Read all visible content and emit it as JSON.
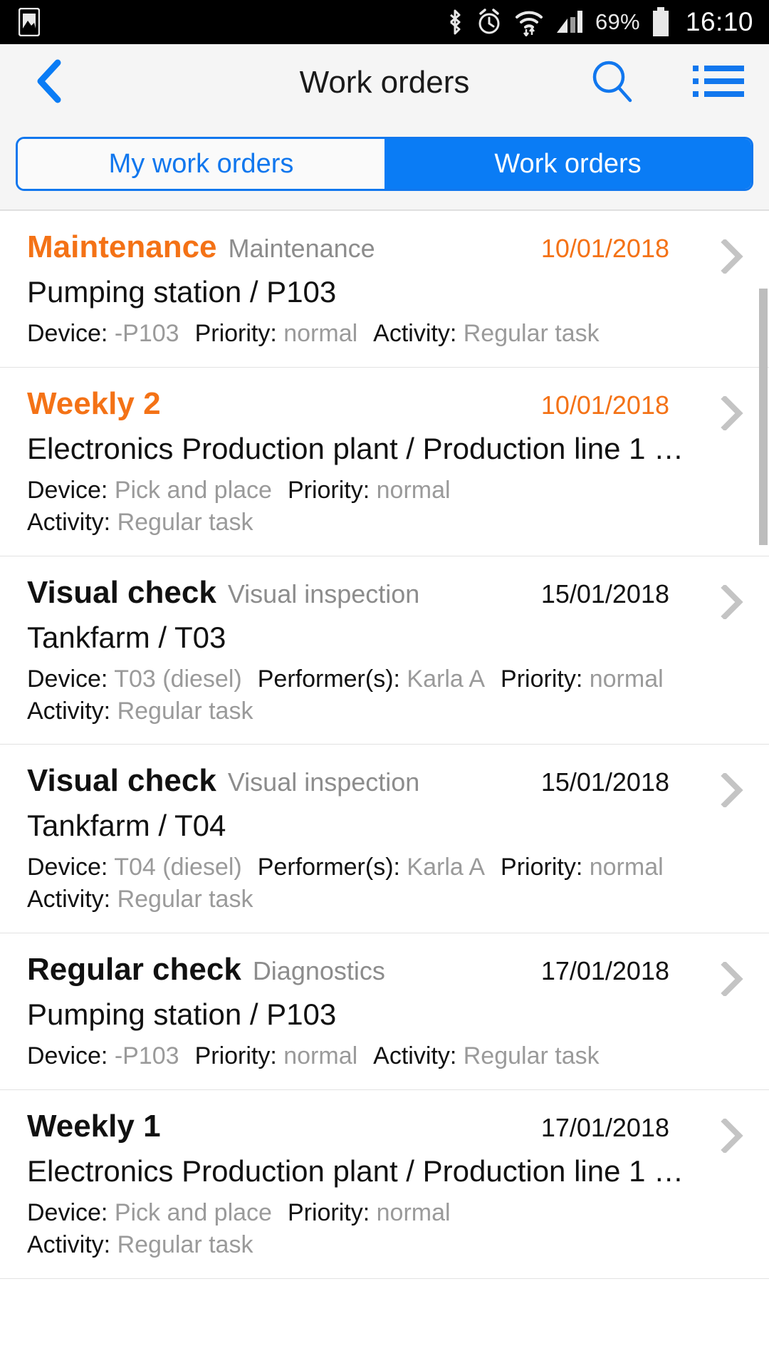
{
  "status_bar": {
    "left_icons": [
      "screenshot-icon"
    ],
    "right_icons": [
      "bluetooth-icon",
      "alarm-icon",
      "wifi-icon",
      "signal-icon"
    ],
    "battery_percent": "69%",
    "time": "16:10"
  },
  "header": {
    "back_icon": "back-chevron-icon",
    "title": "Work orders",
    "search_icon": "search-icon",
    "menu_icon": "list-menu-icon",
    "accent_color": "#1177ee"
  },
  "tabs": {
    "items": [
      {
        "label": "My work orders",
        "selected": false
      },
      {
        "label": "Work orders",
        "selected": true
      }
    ],
    "active_bg": "#0a7cf5",
    "inactive_text": "#1177ee"
  },
  "labels": {
    "device": "Device:",
    "priority": "Priority:",
    "activity": "Activity:",
    "performers": "Performer(s):"
  },
  "colors": {
    "overdue": "#f47216",
    "normal_text": "#111111",
    "muted_text": "#9a9a9a"
  },
  "work_orders": [
    {
      "title": "Maintenance",
      "subtitle": "Maintenance",
      "date": "10/01/2018",
      "overdue": true,
      "location": "Pumping station / P103",
      "detail_lines": [
        [
          {
            "label": "Device:",
            "value": "-P103"
          },
          {
            "label": "Priority:",
            "value": "normal"
          },
          {
            "label": "Activity:",
            "value": "Regular task"
          }
        ]
      ]
    },
    {
      "title": "Weekly 2",
      "subtitle": "",
      "date": "10/01/2018",
      "overdue": true,
      "location": "Electronics Production plant / Production line 1 …",
      "detail_lines": [
        [
          {
            "label": "Device:",
            "value": "Pick and place"
          },
          {
            "label": "Priority:",
            "value": "normal"
          }
        ],
        [
          {
            "label": "Activity:",
            "value": "Regular task"
          }
        ]
      ]
    },
    {
      "title": "Visual check",
      "subtitle": "Visual inspection",
      "date": "15/01/2018",
      "overdue": false,
      "location": "Tankfarm / T03",
      "detail_lines": [
        [
          {
            "label": "Device:",
            "value": "T03 (diesel)"
          },
          {
            "label": "Performer(s):",
            "value": "Karla A"
          },
          {
            "label": "Priority:",
            "value": "normal"
          }
        ],
        [
          {
            "label": "Activity:",
            "value": "Regular task"
          }
        ]
      ]
    },
    {
      "title": "Visual check",
      "subtitle": "Visual inspection",
      "date": "15/01/2018",
      "overdue": false,
      "location": "Tankfarm / T04",
      "detail_lines": [
        [
          {
            "label": "Device:",
            "value": "T04 (diesel)"
          },
          {
            "label": "Performer(s):",
            "value": "Karla A"
          },
          {
            "label": "Priority:",
            "value": "normal"
          }
        ],
        [
          {
            "label": "Activity:",
            "value": "Regular task"
          }
        ]
      ]
    },
    {
      "title": "Regular check",
      "subtitle": "Diagnostics",
      "date": "17/01/2018",
      "overdue": false,
      "location": "Pumping station / P103",
      "detail_lines": [
        [
          {
            "label": "Device:",
            "value": "-P103"
          },
          {
            "label": "Priority:",
            "value": "normal"
          },
          {
            "label": "Activity:",
            "value": "Regular task"
          }
        ]
      ]
    },
    {
      "title": "Weekly 1",
      "subtitle": "",
      "date": "17/01/2018",
      "overdue": false,
      "location": "Electronics Production plant / Production line 1 …",
      "detail_lines": [
        [
          {
            "label": "Device:",
            "value": "Pick and place"
          },
          {
            "label": "Priority:",
            "value": "normal"
          }
        ],
        [
          {
            "label": "Activity:",
            "value": "Regular task"
          }
        ]
      ]
    }
  ]
}
